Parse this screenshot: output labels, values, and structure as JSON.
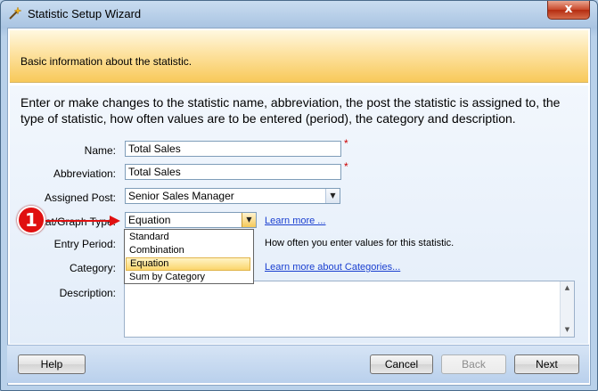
{
  "window": {
    "title": "Statistic Setup Wizard",
    "close_glyph": "x"
  },
  "header": {
    "text": "Basic information about the statistic."
  },
  "intro": "Enter or make changes to the statistic name, abbreviation, the post the statistic is assigned to, the type of statistic, how often values are to be entered (period), the category and description.",
  "form": {
    "name": {
      "label": "Name:",
      "value": "Total Sales",
      "required": "*"
    },
    "abbreviation": {
      "label": "Abbreviation:",
      "value": "Total Sales",
      "required": "*"
    },
    "assigned_post": {
      "label": "Assigned Post:",
      "value": "Senior Sales Manager"
    },
    "graph_type": {
      "label": "Stat/Graph Type:",
      "value": "Equation",
      "options": [
        "Standard",
        "Combination",
        "Equation",
        "Sum by Category"
      ],
      "selected_index": 2,
      "link": "Learn more ..."
    },
    "entry_period": {
      "label": "Entry Period:",
      "hint": "How often you enter values for this statistic."
    },
    "category": {
      "label": "Category:",
      "link": "Learn more about Categories..."
    },
    "description": {
      "label": "Description:",
      "value": ""
    }
  },
  "annotation": {
    "badge": "1"
  },
  "footer": {
    "help": "Help",
    "cancel": "Cancel",
    "back": "Back",
    "next": "Next"
  }
}
